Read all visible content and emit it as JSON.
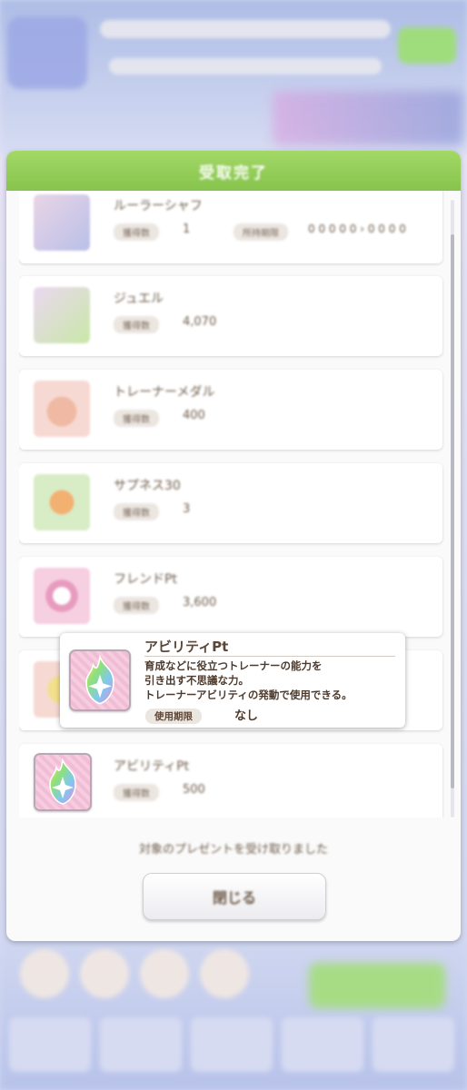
{
  "modal": {
    "title": "受取完了",
    "footer_message": "対象のプレゼントを受け取りました",
    "close_button": "閉じる"
  },
  "items": [
    {
      "name": "ルーラーシャフ",
      "qty_label": "獲得数",
      "qty": "1",
      "extra_label": "所持期限",
      "extra_value": "0 0 0 0 0 › 0 0 0 0",
      "thumb_color": "#e9d4e6"
    },
    {
      "name": "ジュエル",
      "qty_label": "獲得数",
      "qty": "4,070",
      "thumb_color": "#ead8f0"
    },
    {
      "name": "トレーナーメダル",
      "qty_label": "獲得数",
      "qty": "400",
      "thumb_color": "#f6d9d2"
    },
    {
      "name": "サプネス30",
      "qty_label": "獲得数",
      "qty": "3",
      "thumb_color": "#d8ecc6"
    },
    {
      "name": "フレンドPt",
      "qty_label": "獲得数",
      "qty": "3,600",
      "thumb_color": "#f6cfe0"
    },
    {
      "name": "アビリティPt",
      "qty_label": "獲得数",
      "qty": "500",
      "thumb_color": "#f6cfe0"
    }
  ],
  "tooltip": {
    "title": "アビリティPt",
    "description": "育成などに役立つトレーナーの能力を\n引き出す不思議な力。\nトレーナーアビリティの発動で使用できる。",
    "expiry_label": "使用期限",
    "expiry_value": "なし"
  },
  "colors": {
    "header_green": "#8fcb55",
    "text_brown": "#5b4637"
  }
}
